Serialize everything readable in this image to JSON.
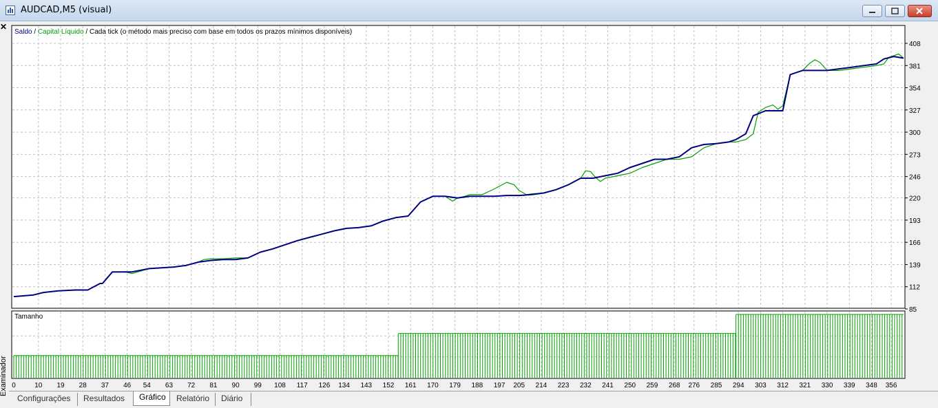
{
  "window": {
    "title": "AUDCAD,M5 (visual)"
  },
  "side_panel": {
    "label": "Examinador"
  },
  "main_chart": {
    "legend_balance": "Saldo",
    "legend_sep1": " / ",
    "legend_equity": "Capital Líquido",
    "legend_sep2": " / ",
    "legend_model": "Cada tick (o método mais preciso com base em todos os prazos mínimos disponíveis)"
  },
  "size_chart": {
    "label": "Tamanho"
  },
  "tabs": [
    {
      "label": "Configurações"
    },
    {
      "label": "Resultados"
    },
    {
      "label": "Gráfico"
    },
    {
      "label": "Relatório"
    },
    {
      "label": "Diário"
    }
  ],
  "active_tab": "Gráfico",
  "colors": {
    "balance": "#000080",
    "equity": "#00a000",
    "volume": "#00a000",
    "grid": "#c0c0c0"
  },
  "chart_data": {
    "type": "line",
    "x_ticks": [
      "0",
      "10",
      "19",
      "28",
      "37",
      "46",
      "54",
      "63",
      "72",
      "81",
      "90",
      "99",
      "108",
      "117",
      "126",
      "134",
      "143",
      "152",
      "161",
      "170",
      "179",
      "188",
      "197",
      "205",
      "214",
      "223",
      "232",
      "241",
      "250",
      "259",
      "268",
      "276",
      "285",
      "294",
      "303",
      "312",
      "321",
      "330",
      "339",
      "348",
      "356"
    ],
    "y_ticks": [
      "85",
      "112",
      "139",
      "166",
      "193",
      "220",
      "246",
      "273",
      "300",
      "327",
      "354",
      "381",
      "408"
    ],
    "ylim": [
      85,
      408
    ],
    "xlim": [
      0,
      361
    ],
    "series": [
      {
        "name": "Saldo",
        "x": [
          0,
          8,
          12,
          18,
          25,
          30,
          35,
          36,
          40,
          45,
          48,
          55,
          60,
          65,
          70,
          75,
          80,
          85,
          90,
          95,
          100,
          105,
          110,
          115,
          120,
          125,
          130,
          135,
          140,
          145,
          150,
          155,
          160,
          165,
          170,
          175,
          180,
          185,
          190,
          195,
          200,
          205,
          210,
          215,
          220,
          225,
          230,
          235,
          240,
          245,
          250,
          255,
          260,
          265,
          270,
          275,
          280,
          285,
          290,
          293,
          297,
          300,
          305,
          310,
          312,
          315,
          320,
          325,
          330,
          335,
          340,
          345,
          350,
          353,
          357,
          361
        ],
        "y": [
          100,
          102,
          105,
          107,
          108,
          108,
          116,
          116,
          130,
          130,
          130,
          134,
          135,
          136,
          138,
          142,
          144,
          145,
          145,
          147,
          154,
          158,
          163,
          168,
          172,
          176,
          180,
          183,
          184,
          186,
          192,
          196,
          198,
          215,
          222,
          222,
          220,
          222,
          222,
          222,
          223,
          223,
          224,
          226,
          230,
          236,
          244,
          244,
          247,
          250,
          257,
          262,
          267,
          267,
          270,
          281,
          285,
          286,
          288,
          291,
          298,
          320,
          326,
          326,
          326,
          370,
          375,
          375,
          375,
          377,
          379,
          381,
          383,
          389,
          392,
          390
        ]
      },
      {
        "name": "Capital Líquido",
        "x": [
          0,
          8,
          12,
          18,
          25,
          30,
          35,
          36,
          40,
          45,
          48,
          55,
          60,
          65,
          70,
          75,
          77,
          80,
          85,
          90,
          95,
          100,
          105,
          110,
          115,
          120,
          125,
          130,
          135,
          140,
          145,
          150,
          155,
          160,
          163,
          165,
          170,
          175,
          178,
          180,
          183,
          185,
          190,
          195,
          200,
          203,
          205,
          208,
          210,
          215,
          220,
          225,
          230,
          232,
          234,
          236,
          238,
          240,
          245,
          250,
          255,
          260,
          265,
          270,
          275,
          280,
          285,
          290,
          293,
          297,
          300,
          302,
          305,
          308,
          310,
          312,
          315,
          320,
          323,
          325,
          327,
          330,
          335,
          340,
          345,
          350,
          353,
          355,
          357,
          359,
          361
        ],
        "y": [
          100,
          102,
          105,
          107,
          108,
          108,
          116,
          116,
          130,
          130,
          128,
          134,
          135,
          136,
          138,
          142,
          145,
          146,
          146,
          147,
          147,
          154,
          158,
          163,
          168,
          172,
          176,
          180,
          183,
          184,
          186,
          192,
          196,
          198,
          208,
          215,
          222,
          222,
          216,
          220,
          222,
          224,
          224,
          231,
          239,
          236,
          229,
          224,
          225,
          226,
          230,
          236,
          244,
          253,
          252,
          245,
          240,
          244,
          247,
          250,
          257,
          262,
          267,
          267,
          270,
          281,
          286,
          288,
          288,
          291,
          298,
          324,
          330,
          333,
          328,
          332,
          370,
          375,
          384,
          388,
          385,
          375,
          375,
          377,
          379,
          381,
          383,
          391,
          393,
          395,
          390
        ]
      }
    ],
    "volume": {
      "name": "Tamanho",
      "segments": [
        {
          "from": 0,
          "to": 156,
          "level": 0.35
        },
        {
          "from": 156,
          "to": 293,
          "level": 0.7
        },
        {
          "from": 293,
          "to": 361,
          "level": 1.0
        }
      ]
    }
  }
}
